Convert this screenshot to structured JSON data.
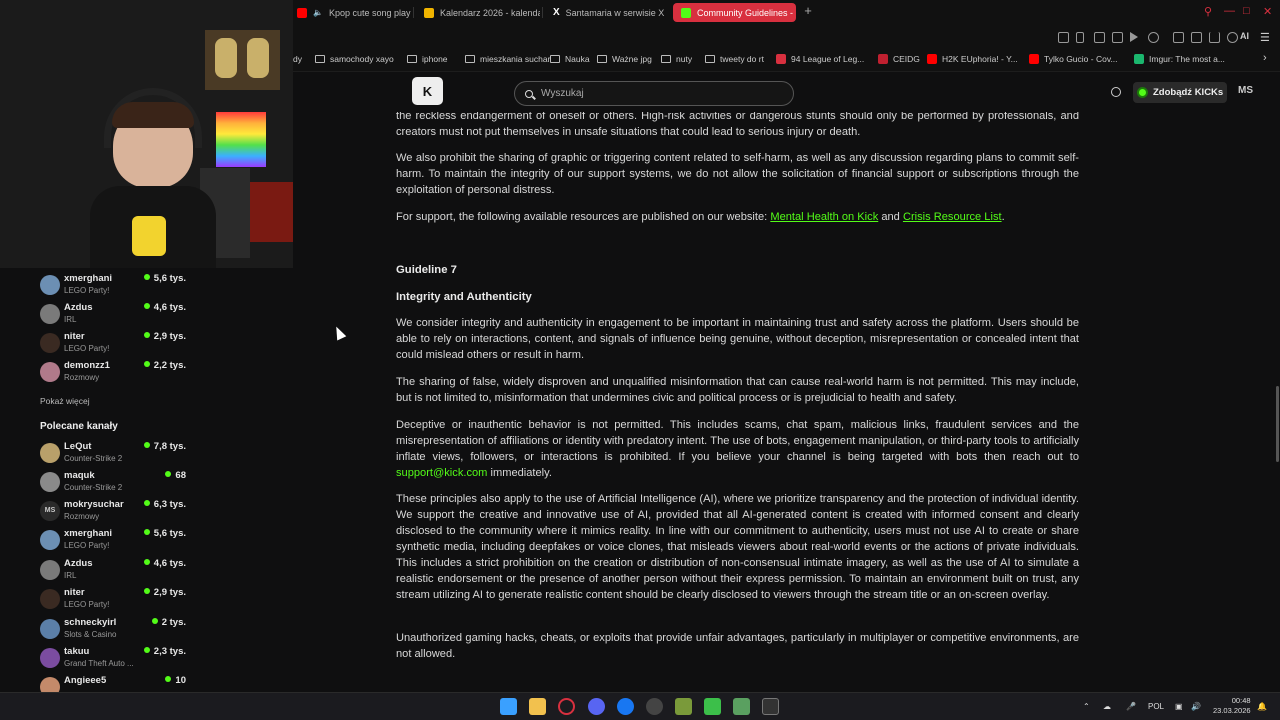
{
  "browser": {
    "tabs": [
      {
        "label": "Kpop cute song playlis",
        "favicon_color": "#ff0000",
        "active": false
      },
      {
        "label": "Kalendarz 2026 - kalenda",
        "favicon_color": "#f0b400",
        "active": false
      },
      {
        "label": "Santamaria w serwisie X:",
        "favicon_color": "#ffffff",
        "active": false
      },
      {
        "label": "Community Guidelines - K",
        "favicon_color": "#53fc18",
        "active": true
      }
    ],
    "new_tab_symbol": "+",
    "bookmarks": [
      {
        "label": "dy",
        "icon": "none"
      },
      {
        "label": "samochody xayo",
        "icon": "folder-icon"
      },
      {
        "label": "iphone",
        "icon": "folder-icon"
      },
      {
        "label": "mieszkania suchar",
        "icon": "folder-icon"
      },
      {
        "label": "Nauka",
        "icon": "folder-icon"
      },
      {
        "label": "Ważne jpg",
        "icon": "folder-icon"
      },
      {
        "label": "nuty",
        "icon": "folder-icon"
      },
      {
        "label": "tweety do rt",
        "icon": "folder-icon"
      },
      {
        "label": "94 League of Leg...",
        "icon": "favicon",
        "color": "#d8303f"
      },
      {
        "label": "CEIDG",
        "icon": "favicon",
        "color": "#c02030"
      },
      {
        "label": "H2K EUphoria! - Y...",
        "icon": "favicon",
        "color": "#ff0000"
      },
      {
        "label": "Tylko Gucio - Cov...",
        "icon": "favicon",
        "color": "#ff0000"
      },
      {
        "label": "Imgur: The most a...",
        "icon": "favicon",
        "color": "#1bb76e"
      }
    ],
    "toolbar_ai_label": "AI"
  },
  "kick": {
    "logo_text": "K",
    "search_placeholder": "Wyszukaj",
    "kicks_button": "Zdobądź KICKs",
    "user_initials": "MS"
  },
  "sidebar": {
    "followed": [
      {
        "name": "xmerghani",
        "game": "LEGO Party!",
        "viewers": "5,6 tys.",
        "avatar_color": "#6c8fb3"
      },
      {
        "name": "Azdus",
        "game": "IRL",
        "viewers": "4,6 tys.",
        "avatar_color": "#7a7a7a"
      },
      {
        "name": "niter",
        "game": "LEGO Party!",
        "viewers": "2,9 tys.",
        "avatar_color": "#3a2a22"
      },
      {
        "name": "demonzz1",
        "game": "Rozmowy",
        "viewers": "2,2 tys.",
        "avatar_color": "#b07a8a"
      }
    ],
    "show_more": "Pokaż więcej",
    "recommended_title": "Polecane kanały",
    "recommended": [
      {
        "name": "LeQut",
        "game": "Counter-Strike 2",
        "viewers": "7,8 tys.",
        "avatar_color": "#b9a06a"
      },
      {
        "name": "maquk",
        "game": "Counter-Strike 2",
        "viewers": "68",
        "avatar_color": "#8a8a8a"
      },
      {
        "name": "mokrysuchar",
        "game": "Rozmowy",
        "viewers": "6,3 tys.",
        "avatar_color": "#2a2a2a"
      },
      {
        "name": "xmerghani",
        "game": "LEGO Party!",
        "viewers": "5,6 tys.",
        "avatar_color": "#6c8fb3"
      },
      {
        "name": "Azdus",
        "game": "IRL",
        "viewers": "4,6 tys.",
        "avatar_color": "#7a7a7a"
      },
      {
        "name": "niter",
        "game": "LEGO Party!",
        "viewers": "2,9 tys.",
        "avatar_color": "#3a2a22"
      },
      {
        "name": "schneckyirl",
        "game": "Slots & Casino",
        "viewers": "2 tys.",
        "avatar_color": "#5b7fa8"
      },
      {
        "name": "takuu",
        "game": "Grand Theft Auto ...",
        "viewers": "2,3 tys.",
        "avatar_color": "#7b4ca0"
      },
      {
        "name": "Angieee5",
        "game": "",
        "viewers": "10",
        "avatar_color": "#c48a6a"
      }
    ],
    "mini_avatar_text": "MS"
  },
  "content": {
    "para_top": "the reckless endangerment of oneself or others. High-risk activities or dangerous stunts should only be performed by professionals, and creators must not put themselves in unsafe situations that could lead to serious injury or death.",
    "para_selfharm": "We also prohibit the sharing of graphic or triggering content related to self-harm, as well as any discussion regarding plans to commit self-harm. To maintain the integrity of our support systems, we do not allow the solicitation of financial support or subscriptions through the exploitation of personal distress.",
    "support_prefix": "For support, the following available resources are published on our website: ",
    "support_link1": "Mental Health on Kick",
    "support_and": " and ",
    "support_link2": "Crisis Resource List",
    "support_suffix": ".",
    "guideline_heading": "Guideline 7",
    "section_title": "Integrity and Authenticity",
    "para_integrity": "We consider integrity and authenticity in engagement to be important in maintaining trust and safety across the platform. Users should be able to rely on interactions, content, and signals of influence being genuine, without deception, misrepresentation or concealed intent that could mislead others or result in harm.",
    "para_misinfo": "The sharing of false, widely disproven and unqualified misinformation that can cause real-world harm is not permitted. This may include, but is not limited to, misinformation that undermines civic and political process or is prejudicial to health and safety.",
    "para_deceptive": "Deceptive or inauthentic behavior is not permitted. This includes scams, chat spam, malicious links, fraudulent services and the misrepresentation of affiliations or identity with predatory intent. The use of bots, engagement manipulation, or third-party tools to artificially inflate views, followers, or interactions is prohibited. If you believe your channel is being targeted with bots then reach out to ",
    "support_email": "support@kick.com",
    "para_deceptive_end": " immediately.",
    "para_ai": "These principles also apply to the use of Artificial Intelligence (AI), where we prioritize transparency and the protection of individual identity. We support the creative and innovative use of AI, provided that all AI-generated content is created with informed consent and clearly disclosed to the community where it mimics reality. In line with our commitment to authenticity, users must not use AI to create or share synthetic media, including deepfakes or voice clones, that misleads viewers about real-world events or the actions of private individuals. This includes a strict prohibition on the creation or distribution of non-consensual intimate imagery, as well as the use of AI to simulate a realistic endorsement or the presence of another person without their express permission. To maintain an environment built on trust, any stream utilizing AI to generate realistic content should be clearly disclosed to viewers through the stream title or an on-screen overlay.",
    "para_hacks": "Unauthorized gaming hacks, cheats, or exploits that provide unfair advantages, particularly in multiplayer or competitive environments, are not allowed."
  },
  "taskbar": {
    "apps": [
      {
        "name": "windows-start-icon",
        "color": "#3aa0ff"
      },
      {
        "name": "file-explorer-icon",
        "color": "#f2c14e"
      },
      {
        "name": "opera-gx-icon",
        "color": "#d8303f"
      },
      {
        "name": "discord-icon",
        "color": "#5865f2"
      },
      {
        "name": "facebook-icon",
        "color": "#1877f2"
      },
      {
        "name": "obs-icon",
        "color": "#444444"
      },
      {
        "name": "minecraft-icon",
        "color": "#7a9a3a"
      },
      {
        "name": "green-cube-icon",
        "color": "#3cbf4a"
      },
      {
        "name": "green-cube-2-icon",
        "color": "#5aa060"
      },
      {
        "name": "terminal-icon",
        "color": "#333333"
      }
    ],
    "language": "POL",
    "time": "00:48",
    "date": "23.03.2026"
  }
}
